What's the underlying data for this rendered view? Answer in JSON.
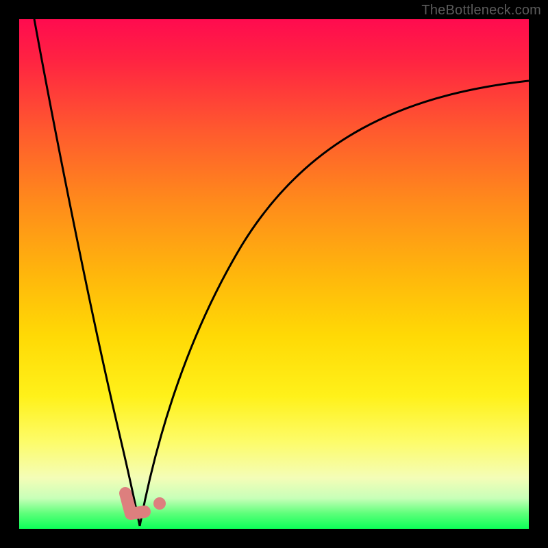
{
  "attribution": "TheBottleneck.com",
  "colors": {
    "page_bg": "#000000",
    "attribution_text": "#5b5b5b",
    "curve_stroke": "#000000",
    "marker_pink": "#dd7f7e",
    "gradient_stops": [
      "#ff0b4f",
      "#ff2342",
      "#ff5a2e",
      "#ff8b1b",
      "#ffb60c",
      "#ffd905",
      "#fff11a",
      "#fdfc6a",
      "#f4fdb7",
      "#c8ffb8",
      "#5dff7a",
      "#0cff58"
    ]
  },
  "chart_data": {
    "type": "line",
    "title": "",
    "xlabel": "",
    "ylabel": "",
    "xlim": [
      0,
      100
    ],
    "ylim": [
      0,
      100
    ],
    "grid": false,
    "legend": false,
    "series": [
      {
        "name": "left-branch",
        "x": [
          3,
          6,
          9,
          12,
          15,
          18,
          20,
          22,
          23.7
        ],
        "values": [
          100,
          80,
          62,
          46,
          32,
          19,
          11,
          5,
          0.5
        ]
      },
      {
        "name": "right-branch",
        "x": [
          23.7,
          28,
          34,
          42,
          52,
          64,
          78,
          90,
          100
        ],
        "values": [
          0.5,
          20,
          40,
          55,
          66,
          75,
          81,
          85,
          88
        ]
      }
    ],
    "markers": [
      {
        "name": "elbow-marker",
        "shape": "L",
        "x": 22.2,
        "y": 2.5
      },
      {
        "name": "dot-marker",
        "shape": "dot",
        "x": 27.5,
        "y": 4.3
      }
    ],
    "notes": "Values are read in percent of the inner plot area (0 = bottom/left, 100 = top/right). No numeric axis ticks are shown in the source image; data points are estimated from curve geometry against the gradient backdrop."
  }
}
